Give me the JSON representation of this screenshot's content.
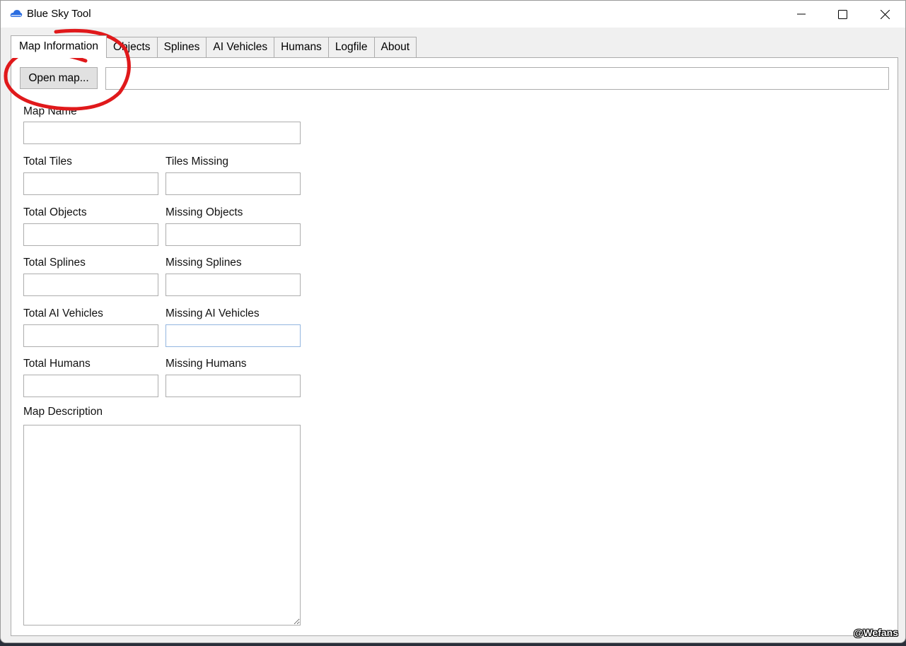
{
  "window": {
    "title": "Blue Sky Tool",
    "icon": "cloud-icon"
  },
  "tabs": [
    {
      "label": "Map Information",
      "active": true
    },
    {
      "label": "Objects"
    },
    {
      "label": "Splines"
    },
    {
      "label": "AI Vehicles"
    },
    {
      "label": "Humans"
    },
    {
      "label": "Logfile"
    },
    {
      "label": "About"
    }
  ],
  "toolbar": {
    "open_label": "Open map...",
    "path_value": ""
  },
  "fields": {
    "map_name": "Map Name",
    "total_tiles": "Total Tiles",
    "tiles_missing": "Tiles Missing",
    "total_objects": "Total Objects",
    "missing_objects": "Missing Objects",
    "total_splines": "Total Splines",
    "missing_splines": "Missing Splines",
    "total_ai": "Total AI Vehicles",
    "missing_ai": "Missing AI Vehicles",
    "total_humans": "Total Humans",
    "missing_humans": "Missing Humans",
    "map_description": "Map Description"
  },
  "annotation_color": "#e0191b",
  "watermark": "@Wefans"
}
